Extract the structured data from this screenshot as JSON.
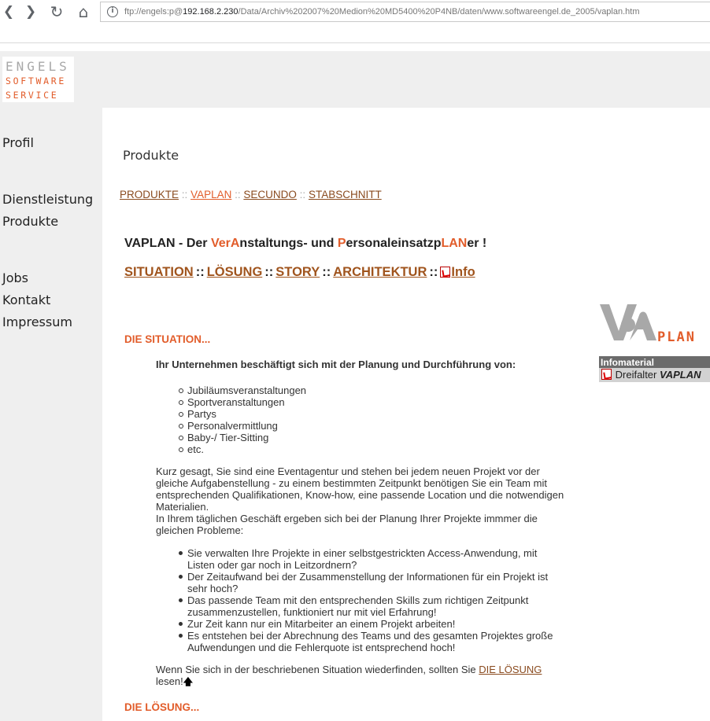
{
  "browser": {
    "back": "❮",
    "forward": "❯",
    "reload": "↻",
    "home": "⌂",
    "url_prefix": "ftp://engels:p@",
    "url_host": "192.168.2.230",
    "url_path": "/Data/Archiv%202007%20Medion%20MD5400%20P4NB/daten/www.softwareengel.de_2005/vaplan.htm"
  },
  "logo": {
    "line1": "ENGELS",
    "line2": "SOFTWARE",
    "line3": "SERVICE"
  },
  "sidebar": {
    "items": [
      "Profil",
      "Dienstleistung",
      "Produkte",
      "Jobs",
      "Kontakt",
      "Impressum"
    ]
  },
  "page_title": "Produkte",
  "breadcrumb": {
    "items": [
      "PRODUKTE",
      "VAPLAN",
      "SECUNDO",
      "STABSCHNITT"
    ],
    "sep": "::"
  },
  "headline": {
    "p1": "VAPLAN - Der ",
    "p2": "Ver",
    "p3": "A",
    "p4": "nstaltungs- und ",
    "p5": "P",
    "p6": "ersonaleinsatzp",
    "p7": "LAN",
    "p8": "er !"
  },
  "subnav": {
    "items": [
      "SITUATION",
      "LÖSUNG",
      "STORY",
      "ARCHITEKTUR",
      "Info"
    ],
    "sep": "::"
  },
  "situation": {
    "title": "DIE SITUATION...",
    "intro": "Ihr Unternehmen beschäftigt sich mit der Planung und Durchführung von:",
    "events": [
      "Jubiläumsveranstaltungen",
      "Sportveranstaltungen",
      "Partys",
      "Personalvermittlung",
      "Baby-/ Tier-Sitting",
      "etc."
    ],
    "para1": "Kurz gesagt, Sie sind eine Eventagentur und stehen bei jedem neuen Projekt vor der gleiche Aufgabenstellung - zu einem bestimmten Zeitpunkt benötigen Sie ein Team mit entsprechenden Qualifikationen, Know-how, eine passende Location und die notwendigen Materialien.",
    "para2": "In Ihrem täglichen Geschäft ergeben sich bei der Planung Ihrer Projekte immmer die gleichen Probleme:",
    "problems": [
      "Sie verwalten Ihre Projekte in einer selbstgestrickten Access-Anwendung, mit Listen oder gar noch in Leitzordnern?",
      "Der Zeitaufwand bei der Zusammenstellung der Informationen für ein Projekt ist sehr hoch?",
      "Das passende Team mit den entsprechenden Skills zum richtigen Zeitpunkt zusammenzustellen, funktioniert nur mit viel Erfahrung!",
      "Zur Zeit kann nur ein Mitarbeiter an einem Projekt arbeiten!",
      "Es entstehen bei der Abrechnung des Teams und des gesamten Projektes große Aufwendungen und die Fehlerquote ist entsprechend hoch!"
    ],
    "closing_pre": "Wenn Sie sich in der beschriebenen Situation wiederfinden, sollten Sie ",
    "closing_link": "DIE LÖSUNG",
    "closing_post": "lesen!",
    "top_arrow": "🡅"
  },
  "loesung": {
    "title": "DIE LÖSUNG..."
  },
  "vaplan_logo": {
    "text": "PLAN"
  },
  "infomaterial": {
    "head": "Infomaterial",
    "item_pre": "Dreifalter ",
    "item_bold": "VAPLAN"
  },
  "colors": {
    "accent": "#e25d2b",
    "link_brown": "#8a4b1f",
    "sidebar_bg": "#efefef"
  }
}
